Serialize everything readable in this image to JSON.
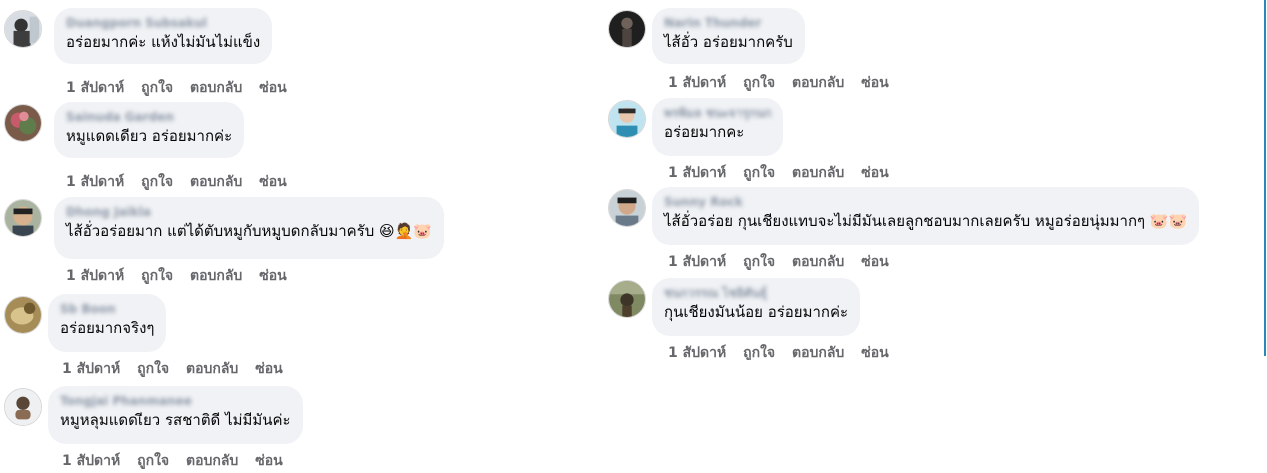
{
  "actions": {
    "time": "1 สัปดาห์",
    "like": "ถูกใจ",
    "reply": "ตอบกลับ",
    "hide": "ซ่อน"
  },
  "left_comments": [
    {
      "author": "Duangporn Subsakul",
      "text": "อร่อยมากค่ะ แห้งไม่มันไม่แข็ง",
      "emoji": ""
    },
    {
      "author": "Sainuda Garden",
      "text": "หมูแดดเดียว อร่อยมากค่ะ",
      "emoji": ""
    },
    {
      "author": "Dhong Jaikla",
      "text": "ไส้อั่วอร่อยมาก แต่ได้ตับหมูกับหมูบดกลับมาครับ",
      "emoji": "😆🤦🐷"
    },
    {
      "author": "Sb Boon",
      "text": "อร่อยมากจริงๆ",
      "emoji": ""
    },
    {
      "author": "Tongjai Phanmanee",
      "text": "หมูหลุมแดดเียว รสชาติดี ไม่มีมันค่ะ",
      "emoji": ""
    }
  ],
  "right_comments": [
    {
      "author": "Narin Thunder",
      "text": "ไส้อั่ว อร่อยมากครับ",
      "emoji": ""
    },
    {
      "author": "พรพิมล ชนะจารุกนก",
      "text": "อร่อยมากคะ",
      "emoji": ""
    },
    {
      "author": "Sunny Rock",
      "text": "ไส้อั่วอร่อย กุนเชียงแทบจะไม่มีมันเลยลูกชอบมากเลยครับ หมูอร่อยนุ่มมากๆ",
      "emoji": "🐷🐷"
    },
    {
      "author": "ชนกวรรณ ไชยิศันธุ์",
      "text": "กุนเชียงมันน้อย อร่อยมากค่ะ",
      "emoji": ""
    }
  ],
  "icons": {
    "avatar": "avatar-photo",
    "divider": "scroll-divider"
  },
  "colors": {
    "bubble": "#f0f2f5",
    "action_text": "#65676b",
    "comment_text": "#050505",
    "divider": "#2c87b8"
  }
}
